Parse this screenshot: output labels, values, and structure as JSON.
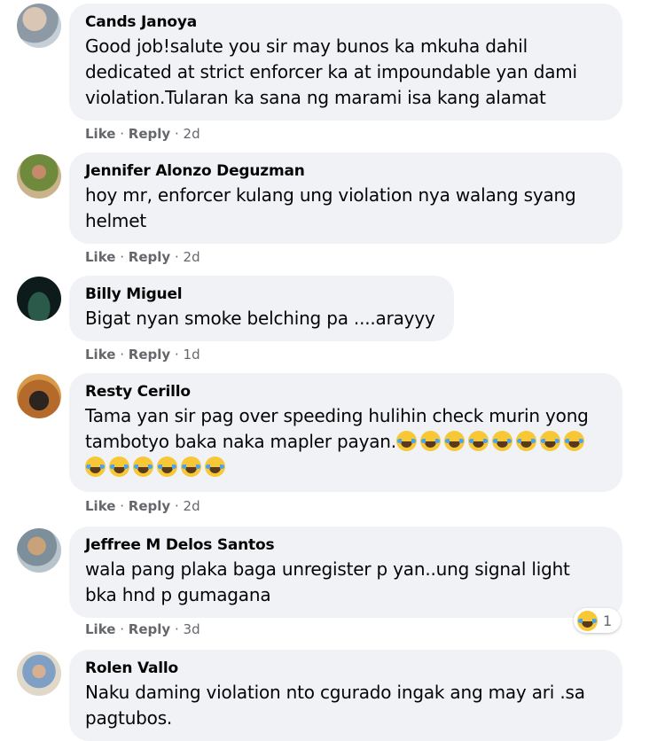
{
  "comments": [
    {
      "author": "Cands Janoya",
      "text": "Good job!salute you sir may bunos ka mkuha dahil dedicated at strict enforcer ka at impoundable yan dami violation.Tularan ka sana ng marami isa kang alamat",
      "like": "Like",
      "reply": "Reply",
      "time": "2d"
    },
    {
      "author": "Jennifer Alonzo Deguzman",
      "text": "hoy mr, enforcer kulang ung violation nya walang syang helmet",
      "like": "Like",
      "reply": "Reply",
      "time": "2d"
    },
    {
      "author": "Billy Miguel",
      "text": "Bigat nyan smoke belching pa ....arayyy",
      "like": "Like",
      "reply": "Reply",
      "time": "1d"
    },
    {
      "author": "Resty Cerillo",
      "text": "Tama yan sir pag over speeding hulihin check murin yong tambotyo baka naka mapler payan.",
      "emoji_count": 14,
      "like": "Like",
      "reply": "Reply",
      "time": "2d"
    },
    {
      "author": "Jeffree M Delos Santos",
      "text": "wala pang plaka baga unregister p yan..ung signal light bka hnd p gumagana",
      "like": "Like",
      "reply": "Reply",
      "time": "3d",
      "reaction_count": "1"
    },
    {
      "author": "Rolen Vallo",
      "text": "Naku daming violation nto cgurado ingak ang may ari .sa pagtubos."
    }
  ],
  "separator": "·",
  "colors": {
    "bubble": "#f0f2f5",
    "meta": "#65676b",
    "text": "#050505"
  }
}
